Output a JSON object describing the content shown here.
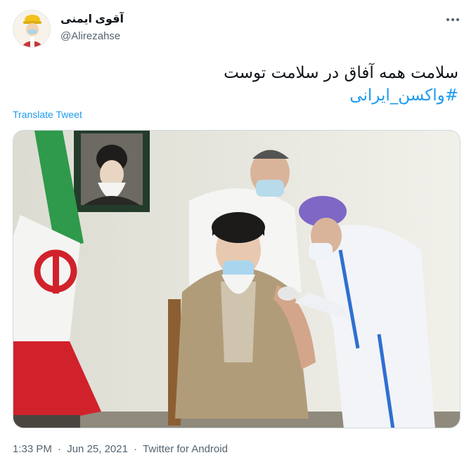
{
  "author": {
    "display_name": "آقوی ایمنی",
    "handle": "@Alirezahse"
  },
  "tweet": {
    "line1": "سلامت همه آفاق در سلامت توست",
    "hashtag": "#واکسن_ایرانی",
    "translate_label": "Translate Tweet"
  },
  "meta": {
    "time": "1:33 PM",
    "date": "Jun 25, 2021",
    "separator": "·",
    "source": "Twitter for Android"
  },
  "icons": {
    "more": "more-horizontal-icon"
  },
  "colors": {
    "link": "#1d9bf0",
    "text": "#0f1419",
    "secondary": "#536471"
  }
}
